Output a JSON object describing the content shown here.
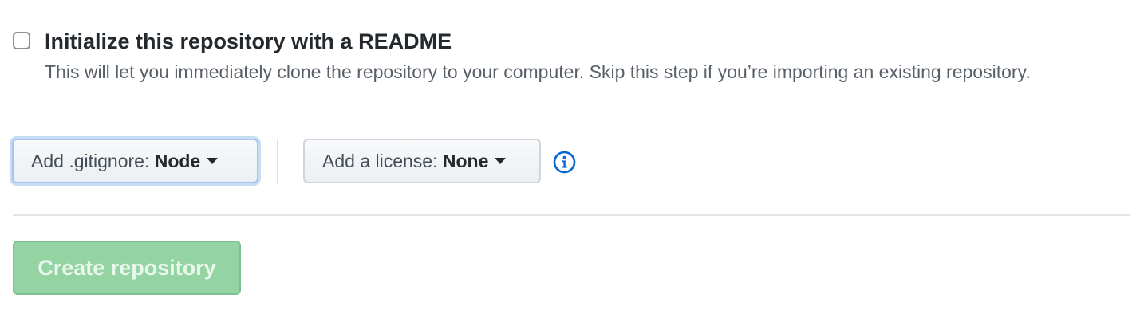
{
  "readme": {
    "checked": false,
    "title": "Initialize this repository with a README",
    "note": "This will let you immediately clone the repository to your computer. Skip this step if you’re importing an existing repository."
  },
  "gitignore": {
    "prefix": "Add .gitignore:",
    "value": "Node"
  },
  "license": {
    "prefix": "Add a license:",
    "value": "None"
  },
  "info_icon": "info-circle-icon",
  "create_button": {
    "label": "Create repository",
    "disabled": true
  },
  "colors": {
    "create_button_bg": "#94d3a2",
    "info_icon": "#0366d6",
    "focus_ring": "#c8dcf6"
  }
}
